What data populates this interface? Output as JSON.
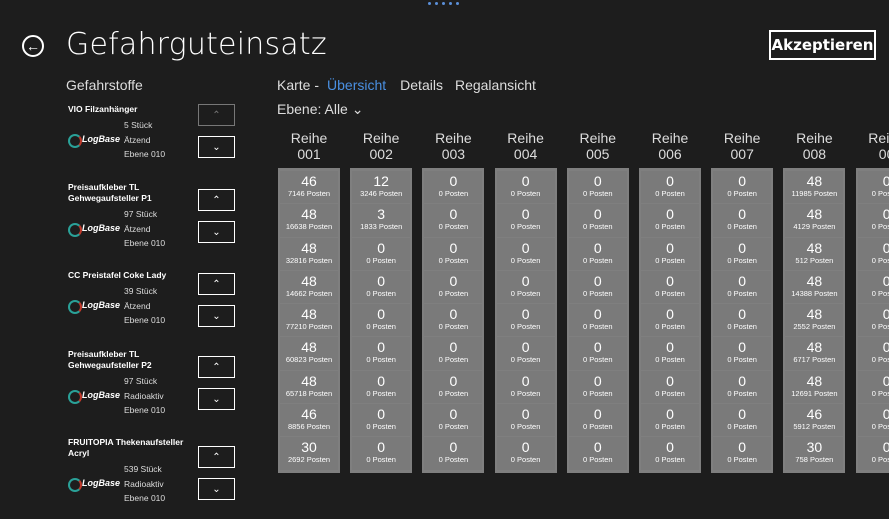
{
  "window": {
    "title": "Gefahrguteinsatz",
    "accept_label": "Akzeptieren"
  },
  "icons": {
    "back": "back-arrow-icon"
  },
  "hazards": {
    "heading": "Gefahrstoffe",
    "logo_text": "LogBase",
    "items": [
      {
        "name": "VIO Filzanhänger",
        "qty": "5 Stück",
        "type": "Ätzend",
        "level": "Ebene 010"
      },
      {
        "name": "Preisaufkleber TL Gehwegaufsteller P1",
        "qty": "97 Stück",
        "type": "Ätzend",
        "level": "Ebene 010"
      },
      {
        "name": "CC Preistafel Coke Lady",
        "qty": "39 Stück",
        "type": "Ätzend",
        "level": "Ebene 010"
      },
      {
        "name": "Preisaufkleber TL Gehwegaufsteller P2",
        "qty": "97 Stück",
        "type": "Radioaktiv",
        "level": "Ebene 010"
      },
      {
        "name": "FRUITOPIA Thekenaufsteller Acryl",
        "qty": "539 Stück",
        "type": "Radioaktiv",
        "level": "Ebene 010"
      }
    ]
  },
  "tabs": {
    "karte": "Karte  -",
    "uebersicht": "Übersicht",
    "details": "Details",
    "regal": "Regalansicht"
  },
  "ebene": "Ebene: Alle ⌄",
  "columns": [
    {
      "label": "Reihe 001",
      "cells": [
        [
          "46",
          "7146 Posten"
        ],
        [
          "48",
          "16638 Posten"
        ],
        [
          "48",
          "32816 Posten"
        ],
        [
          "48",
          "14662 Posten"
        ],
        [
          "48",
          "77210 Posten"
        ],
        [
          "48",
          "60823 Posten"
        ],
        [
          "48",
          "65718 Posten"
        ],
        [
          "46",
          "8856 Posten"
        ],
        [
          "30",
          "2692 Posten"
        ]
      ]
    },
    {
      "label": "Reihe 002",
      "cells": [
        [
          "12",
          "3246 Posten"
        ],
        [
          "3",
          "1833 Posten"
        ],
        [
          "0",
          "0 Posten"
        ],
        [
          "0",
          "0 Posten"
        ],
        [
          "0",
          "0 Posten"
        ],
        [
          "0",
          "0 Posten"
        ],
        [
          "0",
          "0 Posten"
        ],
        [
          "0",
          "0 Posten"
        ],
        [
          "0",
          "0 Posten"
        ]
      ]
    },
    {
      "label": "Reihe 003",
      "cells": [
        [
          "0",
          "0 Posten"
        ],
        [
          "0",
          "0 Posten"
        ],
        [
          "0",
          "0 Posten"
        ],
        [
          "0",
          "0 Posten"
        ],
        [
          "0",
          "0 Posten"
        ],
        [
          "0",
          "0 Posten"
        ],
        [
          "0",
          "0 Posten"
        ],
        [
          "0",
          "0 Posten"
        ],
        [
          "0",
          "0 Posten"
        ]
      ]
    },
    {
      "label": "Reihe 004",
      "cells": [
        [
          "0",
          "0 Posten"
        ],
        [
          "0",
          "0 Posten"
        ],
        [
          "0",
          "0 Posten"
        ],
        [
          "0",
          "0 Posten"
        ],
        [
          "0",
          "0 Posten"
        ],
        [
          "0",
          "0 Posten"
        ],
        [
          "0",
          "0 Posten"
        ],
        [
          "0",
          "0 Posten"
        ],
        [
          "0",
          "0 Posten"
        ]
      ]
    },
    {
      "label": "Reihe 005",
      "cells": [
        [
          "0",
          "0 Posten"
        ],
        [
          "0",
          "0 Posten"
        ],
        [
          "0",
          "0 Posten"
        ],
        [
          "0",
          "0 Posten"
        ],
        [
          "0",
          "0 Posten"
        ],
        [
          "0",
          "0 Posten"
        ],
        [
          "0",
          "0 Posten"
        ],
        [
          "0",
          "0 Posten"
        ],
        [
          "0",
          "0 Posten"
        ]
      ]
    },
    {
      "label": "Reihe 006",
      "cells": [
        [
          "0",
          "0 Posten"
        ],
        [
          "0",
          "0 Posten"
        ],
        [
          "0",
          "0 Posten"
        ],
        [
          "0",
          "0 Posten"
        ],
        [
          "0",
          "0 Posten"
        ],
        [
          "0",
          "0 Posten"
        ],
        [
          "0",
          "0 Posten"
        ],
        [
          "0",
          "0 Posten"
        ],
        [
          "0",
          "0 Posten"
        ]
      ]
    },
    {
      "label": "Reihe 007",
      "cells": [
        [
          "0",
          "0 Posten"
        ],
        [
          "0",
          "0 Posten"
        ],
        [
          "0",
          "0 Posten"
        ],
        [
          "0",
          "0 Posten"
        ],
        [
          "0",
          "0 Posten"
        ],
        [
          "0",
          "0 Posten"
        ],
        [
          "0",
          "0 Posten"
        ],
        [
          "0",
          "0 Posten"
        ],
        [
          "0",
          "0 Posten"
        ]
      ]
    },
    {
      "label": "Reihe 008",
      "cells": [
        [
          "48",
          "11985 Posten"
        ],
        [
          "48",
          "4129 Posten"
        ],
        [
          "48",
          "512 Posten"
        ],
        [
          "48",
          "14388 Posten"
        ],
        [
          "48",
          "2552 Posten"
        ],
        [
          "48",
          "6717 Posten"
        ],
        [
          "48",
          "12691 Posten"
        ],
        [
          "46",
          "5912 Posten"
        ],
        [
          "30",
          "758 Posten"
        ]
      ]
    },
    {
      "label": "Reihe 00",
      "cells": [
        [
          "0",
          "0 Posten"
        ],
        [
          "0",
          "0 Posten"
        ],
        [
          "0",
          "0 Posten"
        ],
        [
          "0",
          "0 Posten"
        ],
        [
          "0",
          "0 Posten"
        ],
        [
          "0",
          "0 Posten"
        ],
        [
          "0",
          "0 Posten"
        ],
        [
          "0",
          "0 Posten"
        ],
        [
          "0",
          "0 Posten"
        ]
      ]
    }
  ]
}
